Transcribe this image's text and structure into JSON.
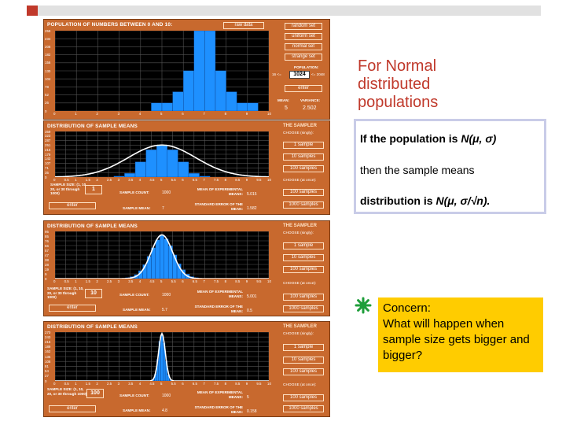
{
  "population_window": {
    "title": "POPULATION OF NUMBERS BETWEEN 0 AND 10:",
    "raw_data_label": "raw data",
    "buttons": [
      "random set",
      "uniform set",
      "normal set",
      "strange set"
    ],
    "population_label": "POPULATION:",
    "population_min_label": "16 <=",
    "population_value": "1024",
    "population_max_label": "<= 2048",
    "enter_label": "enter",
    "mean_label": "MEAN:",
    "variance_label": "VARIANCE:",
    "mean_value": "5",
    "variance_value": "2.502",
    "y_ticks": [
      "259",
      "234",
      "208",
      "182",
      "156",
      "130",
      "104",
      "78",
      "52",
      "26",
      "0"
    ],
    "x_ticks": [
      "0",
      "1",
      "2",
      "3",
      "4",
      "5",
      "6",
      "7",
      "8",
      "9",
      "10"
    ]
  },
  "sampler_common": {
    "dist_title": "DISTRIBUTION OF SAMPLE MEANS",
    "sampler_title": "THE SAMPLER",
    "choose_singly": "CHOOSE (singly):",
    "choose_at_once": "CHOOSE (at once):",
    "one_sample": "1 sample",
    "ten_samples": "10 samples",
    "hundred_samples": "100 samples",
    "thousand_samples": "1000 samples",
    "enter_label": "enter",
    "sample_count_label": "SAMPLE COUNT:",
    "sample_mean_label": "SAMPLE MEAN:",
    "mean_of_exp_label": "MEAN OF EXPERIMENTAL MEANS:",
    "std_err_label": "STANDARD ERROR OF THE MEAN:",
    "x_ticks": [
      "0",
      "0.5",
      "1",
      "1.5",
      "2",
      "2.5",
      "3",
      "3.5",
      "4",
      "4.5",
      "5",
      "5.5",
      "6",
      "6.5",
      "7",
      "7.5",
      "8",
      "8.5",
      "9",
      "9.5",
      "10"
    ]
  },
  "samplers": [
    {
      "sample_size_label": "SAMPLE SIZE: (1, 10, 20, or 30 through 1000)",
      "sample_size": "1",
      "sample_count": "1000",
      "sample_mean": "7",
      "mean_of_means": "5.015",
      "std_error": "1.582",
      "y_ticks": [
        "359",
        "323",
        "287",
        "251",
        "215",
        "179",
        "143",
        "107",
        "71",
        "35",
        "0"
      ]
    },
    {
      "sample_size_label": "SAMPLE SIZE: (1, 10, 20, or 30 through 1000)",
      "sample_size": "10",
      "sample_count": "1000",
      "sample_mean": "5.7",
      "mean_of_means": "5.001",
      "std_error": "0.5",
      "y_ticks": [
        "95",
        "85",
        "76",
        "66",
        "57",
        "47",
        "38",
        "28",
        "19",
        "9",
        "0"
      ]
    },
    {
      "sample_size_label": "SAMPLE SIZE: (1, 10, 20, or 30 through 1000)",
      "sample_size": "100",
      "sample_count": "1000",
      "sample_mean": "4.8",
      "mean_of_means": "5",
      "std_error": "0.158",
      "y_ticks": [
        "270",
        "243",
        "216",
        "189",
        "162",
        "135",
        "108",
        "81",
        "54",
        "27",
        "0"
      ]
    }
  ],
  "heading": [
    "For Normal",
    "distributed",
    "populations"
  ],
  "formula": {
    "line1_prefix": "If the population is ",
    "line1_math": "N(μ, σ)",
    "line2": "then the sample means",
    "line3_prefix": "distribution is ",
    "line3_math": "N(μ, σ/√n)."
  },
  "concern": {
    "title": "Concern:",
    "body": "What will happen when sample size gets bigger and bigger?"
  },
  "colors": {
    "panel_orange": "#c8692e",
    "bar_blue": "#1e90ff",
    "heading_red": "#c0392b",
    "concern_yellow": "#ffcc00",
    "bullet_green": "#1e9e3a"
  },
  "chart_data": [
    {
      "type": "bar",
      "title": "POPULATION OF NUMBERS BETWEEN 0 AND 10:",
      "x": [
        0,
        0.5,
        1,
        1.5,
        2,
        2.5,
        3,
        3.5,
        4,
        4.5,
        5,
        5.5,
        6,
        6.5,
        7,
        7.5,
        8,
        8.5,
        9,
        9.5
      ],
      "values": [
        0,
        0,
        0,
        0,
        0,
        0,
        0,
        0,
        0,
        26,
        26,
        62,
        130,
        259,
        259,
        130,
        62,
        26,
        26,
        0
      ],
      "ylim": [
        0,
        259
      ],
      "xlim": [
        0,
        10
      ]
    },
    {
      "type": "bar",
      "title": "DISTRIBUTION OF SAMPLE MEANS",
      "note_series": "sample size 1",
      "x": [
        3,
        3.5,
        4,
        4.5,
        5,
        5.5,
        6,
        6.5,
        7
      ],
      "values": [
        8,
        30,
        120,
        215,
        250,
        215,
        120,
        30,
        8
      ],
      "curve_mean": 5,
      "curve_sd": 1.58,
      "ylim": [
        0,
        359
      ],
      "xlim": [
        0,
        10
      ]
    },
    {
      "type": "bar",
      "title": "DISTRIBUTION OF SAMPLE MEANS",
      "note_series": "sample size 10",
      "x": [
        3.4,
        3.6,
        3.8,
        4,
        4.2,
        4.4,
        4.6,
        4.8,
        5,
        5.2,
        5.4,
        5.6,
        5.8,
        6,
        6.2,
        6.4,
        6.6
      ],
      "values": [
        2,
        4,
        8,
        16,
        28,
        45,
        62,
        78,
        88,
        80,
        66,
        48,
        30,
        18,
        9,
        4,
        2
      ],
      "curve_mean": 5,
      "curve_sd": 0.5,
      "ylim": [
        0,
        95
      ],
      "xlim": [
        0,
        10
      ]
    },
    {
      "type": "bar",
      "title": "DISTRIBUTION OF SAMPLE MEANS",
      "note_series": "sample size 100",
      "x": [
        4.6,
        4.7,
        4.8,
        4.9,
        5,
        5.1,
        5.2,
        5.3,
        5.4
      ],
      "values": [
        10,
        40,
        120,
        220,
        260,
        210,
        110,
        35,
        8
      ],
      "curve_mean": 5,
      "curve_sd": 0.158,
      "ylim": [
        0,
        270
      ],
      "xlim": [
        0,
        10
      ]
    }
  ]
}
